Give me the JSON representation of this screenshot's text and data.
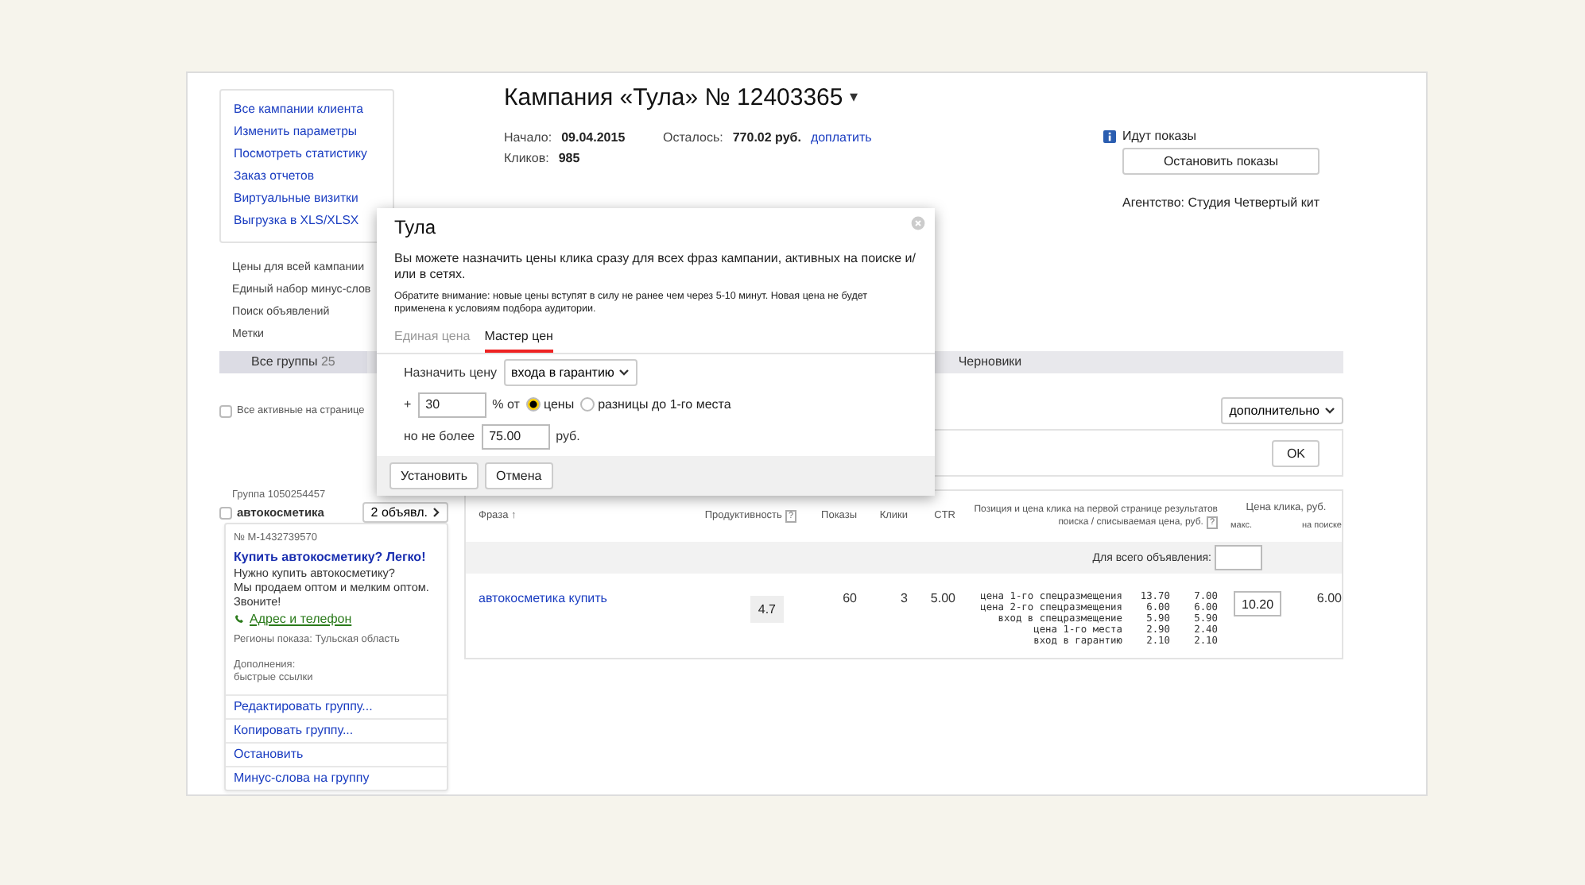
{
  "campaign": {
    "title": "Кампания «Тула» № 12403365",
    "caret": "▾",
    "stats": [
      {
        "label": "Начало:",
        "value": "09.04.2015"
      },
      {
        "label": "Кликов:",
        "value": "985"
      }
    ],
    "balance": {
      "label": "Осталось:",
      "value": "770.02 руб.",
      "link": "доплатить"
    },
    "status": {
      "text": "Идут показы",
      "button": "Остановить показы"
    },
    "agency": "Агентство: Студия Четвертый кит"
  },
  "sidebar": {
    "box_links": [
      "Все кампании клиента",
      "Изменить параметры",
      "Посмотреть статистику",
      "Заказ отчетов",
      "Виртуальные визитки",
      "Выгрузка в XLS/XLSX"
    ],
    "links": [
      "Цены для всей кампании",
      "Единый набор минус-слов",
      "Поиск объявлений",
      "Метки"
    ]
  },
  "group_tabs": [
    {
      "label": "Все группы",
      "count": "25",
      "selected": true
    },
    {
      "label": "Черновики",
      "selected": false
    }
  ],
  "select_all": {
    "label": "Все активные на странице",
    "checked": false
  },
  "more_dropdown": "дополнительно",
  "filter": {
    "button": "OK"
  },
  "group": {
    "id_label": "Группа 1050254457",
    "name": "автокосметика",
    "checked": false,
    "ads_button": "2 объявл."
  },
  "ad": {
    "number": "№ M-1432739570",
    "title": "Купить автокосметику? Легко!",
    "text_lines": [
      "Нужно купить автокосметику?",
      "Мы продаем оптом и мелким оптом.",
      "Звоните!"
    ],
    "contact_link": "Адрес и телефон",
    "regions": "Регионы показа: Тульская область",
    "extras_label": "Дополнения:",
    "extras": "быстрые ссылки",
    "actions": [
      "Редактировать группу...",
      "Копировать группу...",
      "Остановить",
      "Минус-слова на группу"
    ]
  },
  "table": {
    "columns": [
      {
        "label": "Фраза ↑"
      },
      {
        "label": "Продуктивность",
        "help": "?"
      },
      {
        "label": "Показы"
      },
      {
        "label": "Клики"
      },
      {
        "label": "CTR"
      },
      {
        "label": "Позиция и цена клика на первой странице результатов поиска / списываемая цена, руб.",
        "help": "?"
      },
      {
        "label": "Цена клика, руб.",
        "sub": [
          "макс.",
          "на поиске"
        ]
      }
    ],
    "bulk_label": "Для всего объявления:",
    "rows": [
      {
        "phrase": "автокосметика купить",
        "productivity": "4.7",
        "shows": "60",
        "clicks": "3",
        "ctr": "5.00",
        "positions": [
          {
            "label": "цена 1-го спецразмещения",
            "bid": "13.70",
            "price": "7.00"
          },
          {
            "label": "цена 2-го спецразмещения",
            "bid": "6.00",
            "price": "6.00"
          },
          {
            "label": "вход в спецразмещение",
            "bid": "5.90",
            "price": "5.90"
          },
          {
            "label": "цена 1-го места",
            "bid": "2.90",
            "price": "2.40"
          },
          {
            "label": "вход в гарантию",
            "bid": "2.10",
            "price": "2.10"
          }
        ],
        "max_bid": "10.20",
        "search_price": "6.00"
      }
    ]
  },
  "dialog": {
    "title": "Тула",
    "description": "Вы можете назначить цены клика сразу для всех фраз кампании, активных на поиске и/или в сетях.",
    "note": "Обратите внимание: новые цены вступят в силу не ранее чем через 5-10 минут. Новая цена не будет применена к условиям подбора аудитории.",
    "tabs": [
      {
        "label": "Единая цена",
        "selected": false
      },
      {
        "label": "Мастер цен",
        "selected": true
      }
    ],
    "set_price_label": "Назначить цену",
    "set_price_value": "входа в гарантию",
    "plus": "+",
    "percent": "30",
    "percent_of": "% от",
    "radios": [
      {
        "label": "цены",
        "selected": true
      },
      {
        "label": "разницы до 1-го места",
        "selected": false
      }
    ],
    "limit_label": "но не более",
    "limit_value": "75.00",
    "currency": "руб.",
    "buttons": [
      "Установить",
      "Отмена"
    ]
  }
}
